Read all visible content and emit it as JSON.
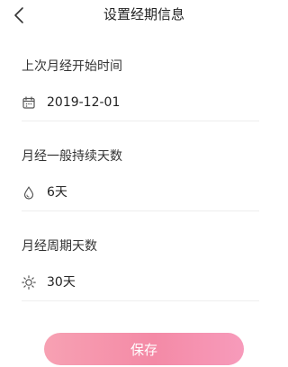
{
  "header": {
    "title": "设置经期信息"
  },
  "last_period": {
    "label": "上次月经开始时间",
    "value": "2019-12-01",
    "icon": "calendar-icon"
  },
  "duration": {
    "label": "月经一般持续天数",
    "value": "6天",
    "icon": "drop-icon"
  },
  "cycle": {
    "label": "月经周期天数",
    "value": "30天",
    "icon": "sun-icon"
  },
  "footer": {
    "save_label": "保存"
  },
  "colors": {
    "accent": "#f48aa6",
    "text": "#222222",
    "divider": "#eeeeee"
  }
}
